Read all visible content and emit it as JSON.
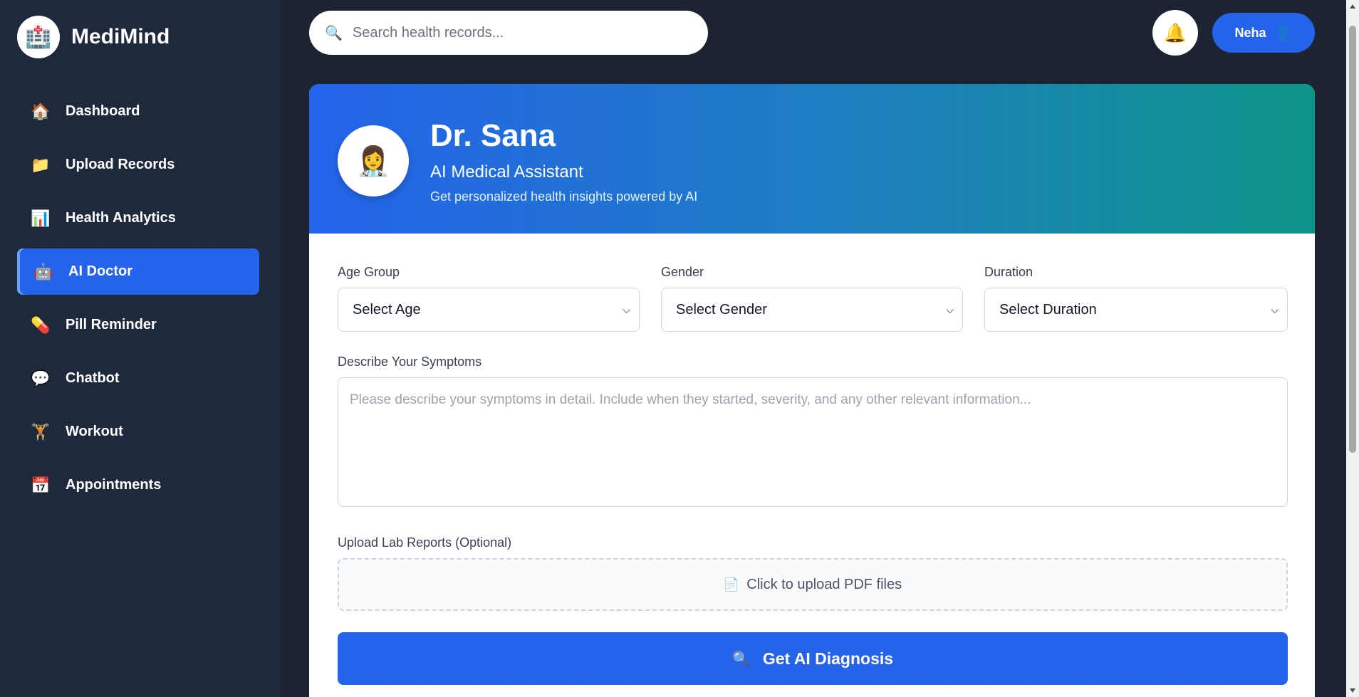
{
  "app": {
    "name": "MediMind",
    "logo_icon": "🏥"
  },
  "sidebar": {
    "items": [
      {
        "label": "Dashboard",
        "icon": "🏠",
        "active": false
      },
      {
        "label": "Upload Records",
        "icon": "📁",
        "active": false
      },
      {
        "label": "Health Analytics",
        "icon": "📊",
        "active": false
      },
      {
        "label": "AI Doctor",
        "icon": "🤖",
        "active": true
      },
      {
        "label": "Pill Reminder",
        "icon": "💊",
        "active": false
      },
      {
        "label": "Chatbot",
        "icon": "💬",
        "active": false
      },
      {
        "label": "Workout",
        "icon": "🏋️",
        "active": false
      },
      {
        "label": "Appointments",
        "icon": "📅",
        "active": false
      }
    ]
  },
  "header": {
    "search_placeholder": "Search health records...",
    "search_icon": "🔍",
    "bell_icon": "🔔",
    "user_name": "Neha",
    "user_icon": "👤"
  },
  "doctor": {
    "avatar": "👩‍⚕️",
    "name": "Dr. Sana",
    "role": "AI Medical Assistant",
    "tagline": "Get personalized health insights powered by AI"
  },
  "form": {
    "age": {
      "label": "Age Group",
      "value": "Select Age"
    },
    "gender": {
      "label": "Gender",
      "value": "Select Gender"
    },
    "duration": {
      "label": "Duration",
      "value": "Select Duration"
    },
    "symptoms": {
      "label": "Describe Your Symptoms",
      "placeholder": "Please describe your symptoms in detail. Include when they started, severity, and any other relevant information..."
    },
    "upload": {
      "label": "Upload Lab Reports (Optional)",
      "text": "Click to upload PDF files",
      "icon": "📄"
    },
    "submit": {
      "label": "Get AI Diagnosis",
      "icon": "🔍"
    }
  },
  "colors": {
    "accent": "#2563eb",
    "sidebar_bg": "#1e2a3c",
    "page_bg": "#1b2430",
    "teal": "#0d9488"
  }
}
